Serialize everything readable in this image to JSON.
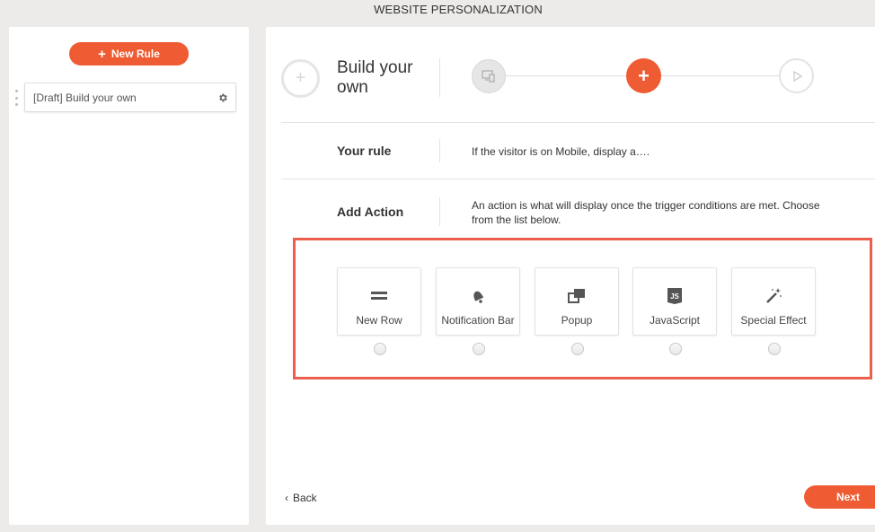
{
  "page": {
    "title": "WEBSITE PERSONALIZATION"
  },
  "sidebar": {
    "new_rule_label": "New Rule",
    "rules": [
      {
        "label": "[Draft] Build your own"
      }
    ]
  },
  "wizard": {
    "title": "Build your own",
    "steps": [
      {
        "icon": "device-icon",
        "state": "done"
      },
      {
        "icon": "plus-icon",
        "state": "active"
      },
      {
        "icon": "play-icon",
        "state": "pending"
      }
    ]
  },
  "your_rule": {
    "label": "Your rule",
    "text": "If the visitor is on Mobile, display a…."
  },
  "add_action": {
    "label": "Add Action",
    "text": "An action is what will display once the trigger conditions are met. Choose from the list below."
  },
  "actions": [
    {
      "label": "New Row",
      "icon": "equals-icon"
    },
    {
      "label": "Notification Bar",
      "icon": "bell-icon"
    },
    {
      "label": "Popup",
      "icon": "popup-icon"
    },
    {
      "label": "JavaScript",
      "icon": "js-icon"
    },
    {
      "label": "Special Effect",
      "icon": "magic-wand-icon"
    }
  ],
  "nav": {
    "back_label": "Back",
    "next_label": "Next"
  },
  "colors": {
    "accent": "#ef5b32",
    "highlight": "#ec5f4f"
  }
}
